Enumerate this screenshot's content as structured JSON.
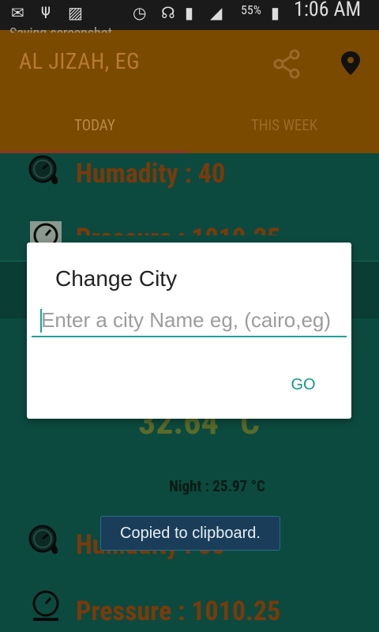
{
  "status_bar": {
    "battery_percent": "55%",
    "time": "1:06 AM",
    "icons": [
      "mail-icon",
      "usb-icon",
      "image-icon",
      "alarm-icon",
      "headset-icon",
      "sim-icon",
      "signal-icon",
      "battery-icon"
    ]
  },
  "screenshot_notice": "Saving screenshot...",
  "toolbar": {
    "city": "AL JIZAH, EG",
    "share_icon": "share-icon",
    "location_icon": "location-pin-icon"
  },
  "tabs": [
    {
      "label": "TODAY",
      "selected": true
    },
    {
      "label": "THIS WEEK",
      "selected": false
    }
  ],
  "content": {
    "humidity_top": "Humadity : 40",
    "pressure_top": "Pressure : 1010.25",
    "temperature": "32.64 °C",
    "night": "Night : 25.97 °C",
    "humidity_bottom": "Humadity : 38",
    "pressure_bottom": "Pressure : 1010.25"
  },
  "dialog": {
    "title": "Change City",
    "input_placeholder": "Enter a city Name eg, (cairo,eg)",
    "input_value": "",
    "go_label": "GO"
  },
  "toast": {
    "text": "Copied to clipboard."
  },
  "colors": {
    "accent": "#14978e",
    "toolbar": "#7a4a00",
    "content_bg": "#0c4a3f"
  }
}
